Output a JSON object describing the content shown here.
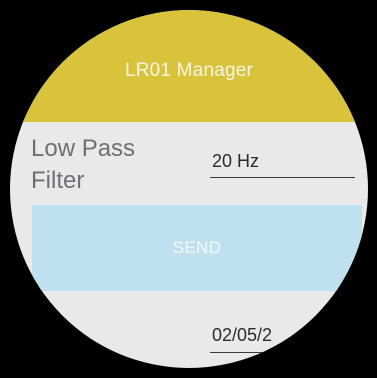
{
  "app_bar": {
    "title": "LR01 Manager",
    "color": "#d8c33a"
  },
  "filter": {
    "label_line1": "Low Pass",
    "label_line2": "Filter",
    "value": "20 Hz"
  },
  "send_button": {
    "label": "SEND",
    "color": "#bfe0ee"
  },
  "date": {
    "value": "02/05/2"
  }
}
